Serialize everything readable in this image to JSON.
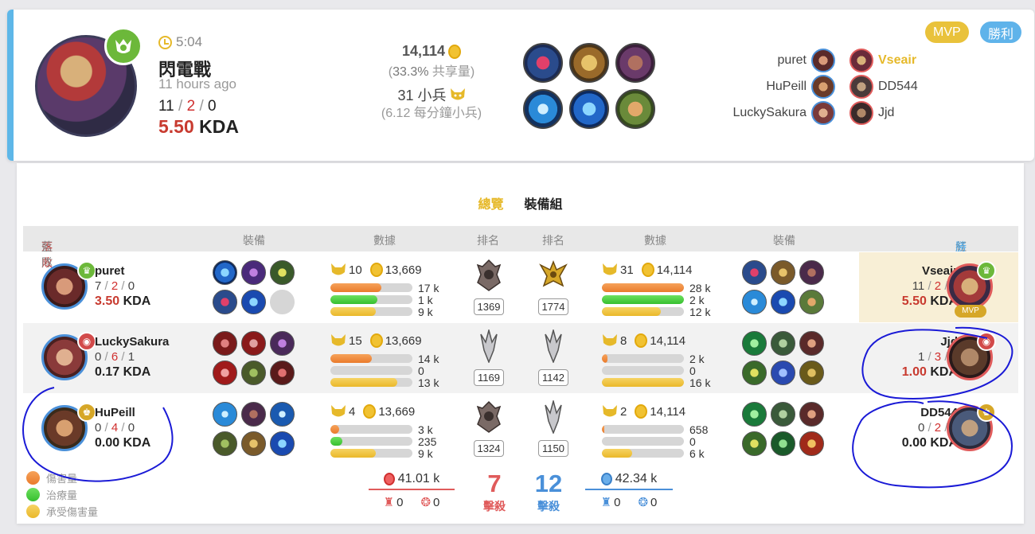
{
  "header": {
    "duration": "5:04",
    "mode": "閃電戰",
    "time_ago": "11 hours ago",
    "kills": "11",
    "deaths": "2",
    "assists": "0",
    "kda_value": "5.50",
    "kda_label": "KDA",
    "gold": "14,114",
    "gold_share_pct": "33.3%",
    "gold_share_label": "共享量",
    "minions": "31 小兵",
    "minions_per_min": "(6.12 每分鐘小兵)",
    "badge_mvp": "MVP",
    "badge_result": "勝利",
    "blue_team": [
      "puret",
      "HuPeill",
      "LuckySakura"
    ],
    "red_team": [
      "Vseair",
      "DD544",
      "Jjd"
    ]
  },
  "tabs": {
    "overview": "總覽",
    "builds": "裝備組"
  },
  "table_head": {
    "lose": "落敗",
    "blue": "藍隊",
    "items": "裝備",
    "stats": "數據",
    "rank": "排名",
    "red": "紅隊",
    "win": "勝利"
  },
  "rows": [
    {
      "blue": {
        "name": "puret",
        "k": "7",
        "d": "2",
        "a": "0",
        "kda": "3.50",
        "minions": "10",
        "gold": "13,669",
        "dmg": "17 k",
        "heal": "1 k",
        "taken": "9 k",
        "rank": "1369",
        "dmg_fill": 0.62,
        "heal_fill": 0.57,
        "taken_fill": 0.55
      },
      "red": {
        "name": "Vseair",
        "k": "11",
        "d": "2",
        "a": "0",
        "kda": "5.50",
        "minions": "31",
        "gold": "14,114",
        "dmg": "28 k",
        "heal": "2 k",
        "taken": "12 k",
        "rank": "1774",
        "dmg_fill": 1.0,
        "heal_fill": 1.0,
        "taken_fill": 0.72
      }
    },
    {
      "blue": {
        "name": "LuckySakura",
        "k": "0",
        "d": "6",
        "a": "1",
        "kda": "0.17",
        "minions": "15",
        "gold": "13,669",
        "dmg": "14 k",
        "heal": "0",
        "taken": "13 k",
        "rank": "1169",
        "dmg_fill": 0.5,
        "heal_fill": 0.0,
        "taken_fill": 0.82
      },
      "red": {
        "name": "Jjd",
        "k": "1",
        "d": "3",
        "a": "2",
        "kda": "1.00",
        "minions": "8",
        "gold": "14,114",
        "dmg": "2 k",
        "heal": "0",
        "taken": "16 k",
        "rank": "1142",
        "dmg_fill": 0.07,
        "heal_fill": 0.0,
        "taken_fill": 1.0
      }
    },
    {
      "blue": {
        "name": "HuPeill",
        "k": "0",
        "d": "4",
        "a": "0",
        "kda": "0.00",
        "minions": "4",
        "gold": "13,669",
        "dmg": "3 k",
        "heal": "235",
        "taken": "9 k",
        "rank": "1324",
        "dmg_fill": 0.11,
        "heal_fill": 0.15,
        "taken_fill": 0.55
      },
      "red": {
        "name": "DD544",
        "k": "0",
        "d": "2",
        "a": "0",
        "kda": "0.00",
        "minions": "2",
        "gold": "14,114",
        "dmg": "658",
        "heal": "0",
        "taken": "6 k",
        "rank": "1150",
        "dmg_fill": 0.03,
        "heal_fill": 0.0,
        "taken_fill": 0.37
      }
    }
  ],
  "mvp_tag": "MVP",
  "legend": {
    "damage": "傷害量",
    "healing": "治療量",
    "taken": "承受傷害量"
  },
  "totals": {
    "blue_gold": "41.01 k",
    "blue_towers": "0",
    "blue_phoenix": "0",
    "blue_kills": "7",
    "red_gold": "42.34 k",
    "red_towers": "0",
    "red_phoenix": "0",
    "red_kills": "12",
    "kills_label": "擊殺"
  },
  "colors": {
    "blue_accent": "#5eb7e8",
    "gold": "#e6b92a",
    "red": "#d0302f",
    "green_badge": "#6cb83a",
    "annotation_ink": "#1a1ad6"
  }
}
